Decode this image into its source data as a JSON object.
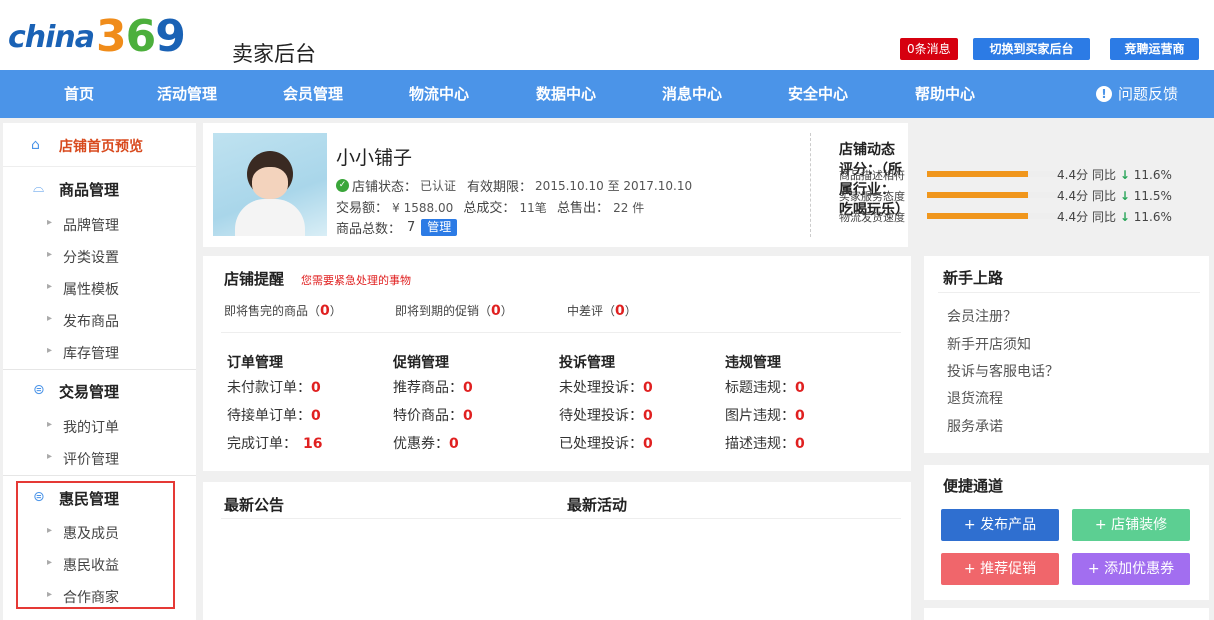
{
  "header": {
    "logo_word": "china",
    "logo_digit_3": "3",
    "logo_digit_6": "6",
    "logo_digit_9": "9",
    "title": "卖家后台",
    "messages_label": "0条消息",
    "switch_label": "切换到买家后台",
    "apply_label": "竞聘运营商"
  },
  "nav": {
    "items": [
      "首页",
      "活动管理",
      "会员管理",
      "物流中心",
      "数据中心",
      "消息中心",
      "安全中心",
      "帮助中心"
    ],
    "feedback_label": "问题反馈",
    "feedback_icon": "!"
  },
  "sidebar": {
    "home_label": "店铺首页预览",
    "groups": [
      {
        "label": "商品管理",
        "icon": "shopping-bag-icon",
        "items": [
          "品牌管理",
          "分类设置",
          "属性模板",
          "发布商品",
          "库存管理"
        ]
      },
      {
        "label": "交易管理",
        "icon": "trade-icon",
        "items": [
          "我的订单",
          "评价管理"
        ]
      },
      {
        "label": "惠民管理",
        "icon": "benefit-icon",
        "items": [
          "惠及成员",
          "惠民收益",
          "合作商家"
        ]
      }
    ]
  },
  "store": {
    "name": "小小铺子",
    "status_label": "店铺状态：",
    "status_value": "已认证",
    "valid_label": "有效期限：",
    "valid_value": "2015.10.10 至 2017.10.10",
    "trade_label": "交易额：",
    "trade_value": "¥ 1588.00",
    "deals_label": "总成交：",
    "deals_value": "11笔",
    "sold_label": "总售出：",
    "sold_value": "22 件",
    "goods_label": "商品总数：",
    "goods_value": "7",
    "manage_label": "管理"
  },
  "rating": {
    "title": "店铺动态评分：（所属行业：吃喝玩乐）",
    "rows": [
      {
        "label": "商品描述相符",
        "score": "4.4分",
        "compare": "同比",
        "arrow": "↓",
        "pct": "11.6%",
        "fill": 0.78
      },
      {
        "label": "买家服务态度",
        "score": "4.4分",
        "compare": "同比",
        "arrow": "↓",
        "pct": "11.5%",
        "fill": 0.78
      },
      {
        "label": "物流发货速度",
        "score": "4.4分",
        "compare": "同比",
        "arrow": "↓",
        "pct": "11.6%",
        "fill": 0.78
      }
    ]
  },
  "reminder": {
    "title": "店铺提醒",
    "subtitle": "您需要紧急处理的事物",
    "alerts": [
      {
        "label": "即将售完的商品（",
        "count": "0",
        "close": "）"
      },
      {
        "label": "即将到期的促销（",
        "count": "0",
        "close": "）"
      },
      {
        "label": "中差评（",
        "count": "0",
        "close": "）"
      }
    ],
    "columns": [
      {
        "title": "订单管理",
        "items": [
          {
            "label": "未付款订单：",
            "count": "0"
          },
          {
            "label": "待接单订单：",
            "count": "0"
          },
          {
            "label": "完成订单：",
            "count": "16"
          }
        ]
      },
      {
        "title": "促销管理",
        "items": [
          {
            "label": "推荐商品：",
            "count": "0"
          },
          {
            "label": "特价商品：",
            "count": "0"
          },
          {
            "label": "优惠券：",
            "count": "0"
          }
        ]
      },
      {
        "title": "投诉管理",
        "items": [
          {
            "label": "未处理投诉：",
            "count": "0"
          },
          {
            "label": "待处理投诉：",
            "count": "0"
          },
          {
            "label": "已处理投诉：",
            "count": "0"
          }
        ]
      },
      {
        "title": "违规管理",
        "items": [
          {
            "label": "标题违规：",
            "count": "0"
          },
          {
            "label": "图片违规：",
            "count": "0"
          },
          {
            "label": "描述违规：",
            "count": "0"
          }
        ]
      }
    ]
  },
  "notices": {
    "announcement_title": "最新公告",
    "activity_title": "最新活动"
  },
  "guide": {
    "title": "新手上路",
    "links": [
      "会员注册？",
      "新手开店须知",
      "投诉与客服电话？",
      "退货流程",
      "服务承诺"
    ]
  },
  "quick": {
    "title": "便捷通道",
    "buttons": [
      {
        "label": "+ 发布产品",
        "color": "#2f6fd0"
      },
      {
        "label": "+ 店铺装修",
        "color": "#5ccf92"
      },
      {
        "label": "+ 推荐促销",
        "color": "#f0666b"
      },
      {
        "label": "+ 添加优惠券",
        "color": "#a26ef0"
      }
    ]
  },
  "colors": {
    "nav_bg": "#4b94e8",
    "primary": "#2c7be5",
    "alert_red": "#e02020",
    "rating_bar": "#f0961c",
    "highlight_box": "#e53935"
  }
}
